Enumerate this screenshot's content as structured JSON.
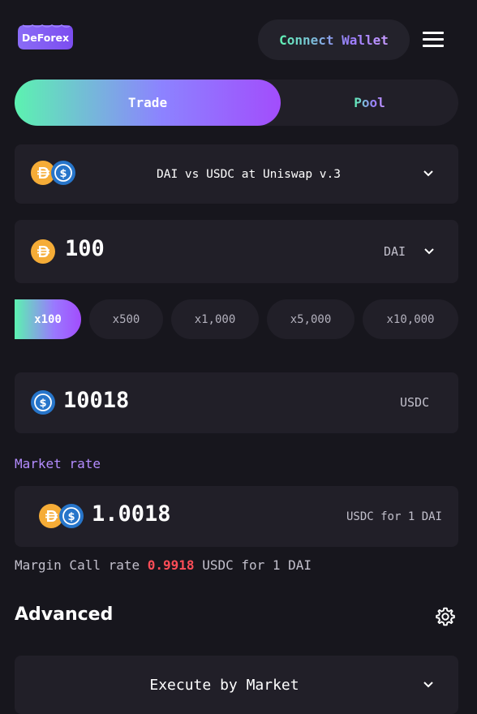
{
  "header": {
    "logo_text": "DeForex",
    "connect_wallet_label": "Connect Wallet",
    "menu_icon": "hamburger-menu-icon"
  },
  "tabs": [
    {
      "label": "Trade",
      "active": true
    },
    {
      "label": "Pool",
      "active": false
    }
  ],
  "pair": {
    "label": "DAI vs USDC at Uniswap v.3",
    "icons": [
      "dai-icon",
      "usdc-icon"
    ]
  },
  "amount": {
    "value": "100",
    "currency": "DAI",
    "icon": "dai-icon"
  },
  "leverage": {
    "options": [
      "x100",
      "x500",
      "x1,000",
      "x5,000",
      "x10,000"
    ],
    "selected": "x100"
  },
  "result": {
    "value": "10018",
    "currency": "USDC",
    "icon": "usdc-icon"
  },
  "market_rate": {
    "label": "Market rate",
    "value": "1.0018",
    "unit": "USDC for 1 DAI"
  },
  "margin_call": {
    "prefix": "Margin Call rate ",
    "value": "0.9918",
    "suffix": " USDC for 1 DAI"
  },
  "advanced": {
    "title": "Advanced",
    "settings_icon": "gear-icon"
  },
  "execution": {
    "selected": "Execute by Market"
  },
  "colors": {
    "background": "#17161d",
    "card": "#211f28",
    "accent_green": "#5cf2b0",
    "accent_purple": "#a24dfc",
    "dai": "#f5ac37",
    "usdc": "#2775ca",
    "danger": "#ff4d57",
    "label_purple": "#b48cff"
  }
}
